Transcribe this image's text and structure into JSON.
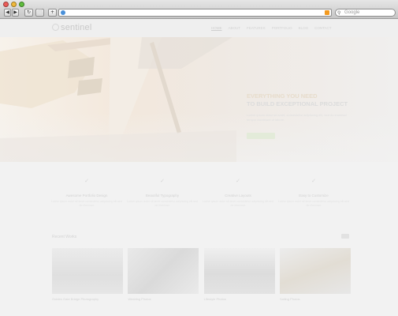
{
  "browser": {
    "nav": {
      "back": "◀",
      "forward": "▶",
      "reload": "↻",
      "tabs": "⬜",
      "add": "+"
    },
    "search_placeholder": "Google",
    "icons": [
      "close-light",
      "minimize-light",
      "zoom-light",
      "globe-icon",
      "rss-icon",
      "search-icon"
    ]
  },
  "site": {
    "logo_text": "sentinel",
    "menu": [
      "HOME",
      "ABOUT",
      "FEATURES",
      "PORTFOLIO",
      "BLOG",
      "CONTACT"
    ],
    "hero": {
      "title_highlight": "EVERYTHING YOU NEED",
      "title_rest": "TO BUILD EXCEPTIONAL PROJECT",
      "subtitle": "Lorem ipsum dolor sit amet, consectetur adipiscing elit, sed do eiusmod tempor incididunt ut labore."
    },
    "features": [
      {
        "icon": "✓",
        "title": "Awesome Portfolio Design",
        "text": "Lorem ipsum dolor sit amet consectetur adipiscing elit sed do eiusmod."
      },
      {
        "icon": "✓",
        "title": "Beautiful Typography",
        "text": "Lorem ipsum dolor sit amet consectetur adipiscing elit sed do eiusmod."
      },
      {
        "icon": "✓",
        "title": "Creative Layouts",
        "text": "Lorem ipsum dolor sit amet consectetur adipiscing elit sed do eiusmod."
      },
      {
        "icon": "✓",
        "title": "Easy to Customize",
        "text": "Lorem ipsum dolor sit amet consectetur adipiscing elit sed do eiusmod."
      }
    ],
    "recent_title": "Recent Works",
    "works": [
      {
        "caption": "Golden Gate Bridge Photography"
      },
      {
        "caption": "Wedding Photos"
      },
      {
        "caption": "Lifestyle Photos"
      },
      {
        "caption": "Sailing Photos"
      }
    ]
  }
}
